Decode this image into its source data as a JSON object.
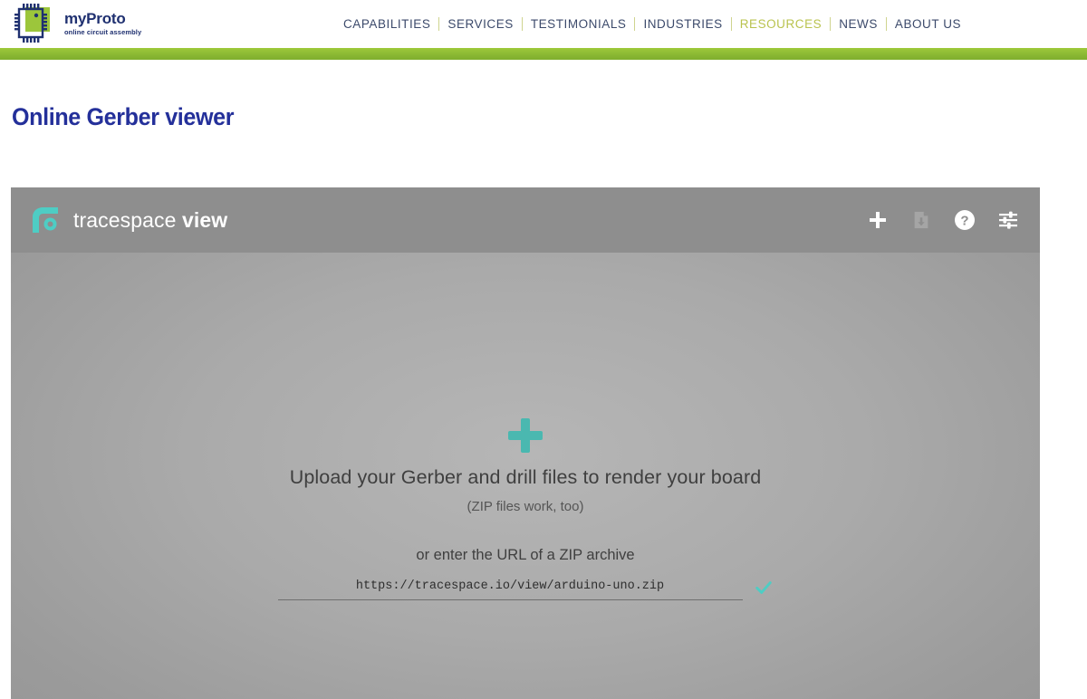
{
  "site": {
    "brand": {
      "name": "myProto",
      "tagline": "online circuit assembly",
      "logo_icon": "chip-logo-icon",
      "chip_color": "#9cc63b",
      "pin_color": "#1f3070"
    },
    "nav": [
      {
        "label": "CAPABILITIES",
        "active": false
      },
      {
        "label": "SERVICES",
        "active": false
      },
      {
        "label": "TESTIMONIALS",
        "active": false
      },
      {
        "label": "INDUSTRIES",
        "active": false
      },
      {
        "label": "RESOURCES",
        "active": true
      },
      {
        "label": "NEWS",
        "active": false
      },
      {
        "label": "ABOUT US",
        "active": false
      }
    ],
    "accent_bar_color": "#8cbe34",
    "nav_active_color": "#b9c34e"
  },
  "page": {
    "title": "Online Gerber viewer",
    "title_color": "#24309a"
  },
  "viewer": {
    "brand_name": "tracespace",
    "brand_name_bold": "view",
    "brand_mark_icon": "tracespace-logo-icon",
    "accent_color": "#4ecdc4",
    "toolbar": [
      {
        "icon": "plus-icon",
        "label": "Add files",
        "enabled": true
      },
      {
        "icon": "file-download-icon",
        "label": "Download render",
        "enabled": false
      },
      {
        "icon": "help-circle-icon",
        "label": "Help",
        "enabled": true
      },
      {
        "icon": "settings-sliders-icon",
        "label": "Settings",
        "enabled": true
      }
    ],
    "dropzone": {
      "plus_icon": "plus-large-icon",
      "headline": "Upload your Gerber and drill files to render your board",
      "subtext": "(ZIP files work, too)",
      "url_label": "or enter the URL of a ZIP archive",
      "url_value": "https://tracespace.io/view/arduino-uno.zip",
      "url_placeholder": "https://tracespace.io/view/arduino-uno.zip",
      "submit_icon": "check-icon"
    }
  }
}
